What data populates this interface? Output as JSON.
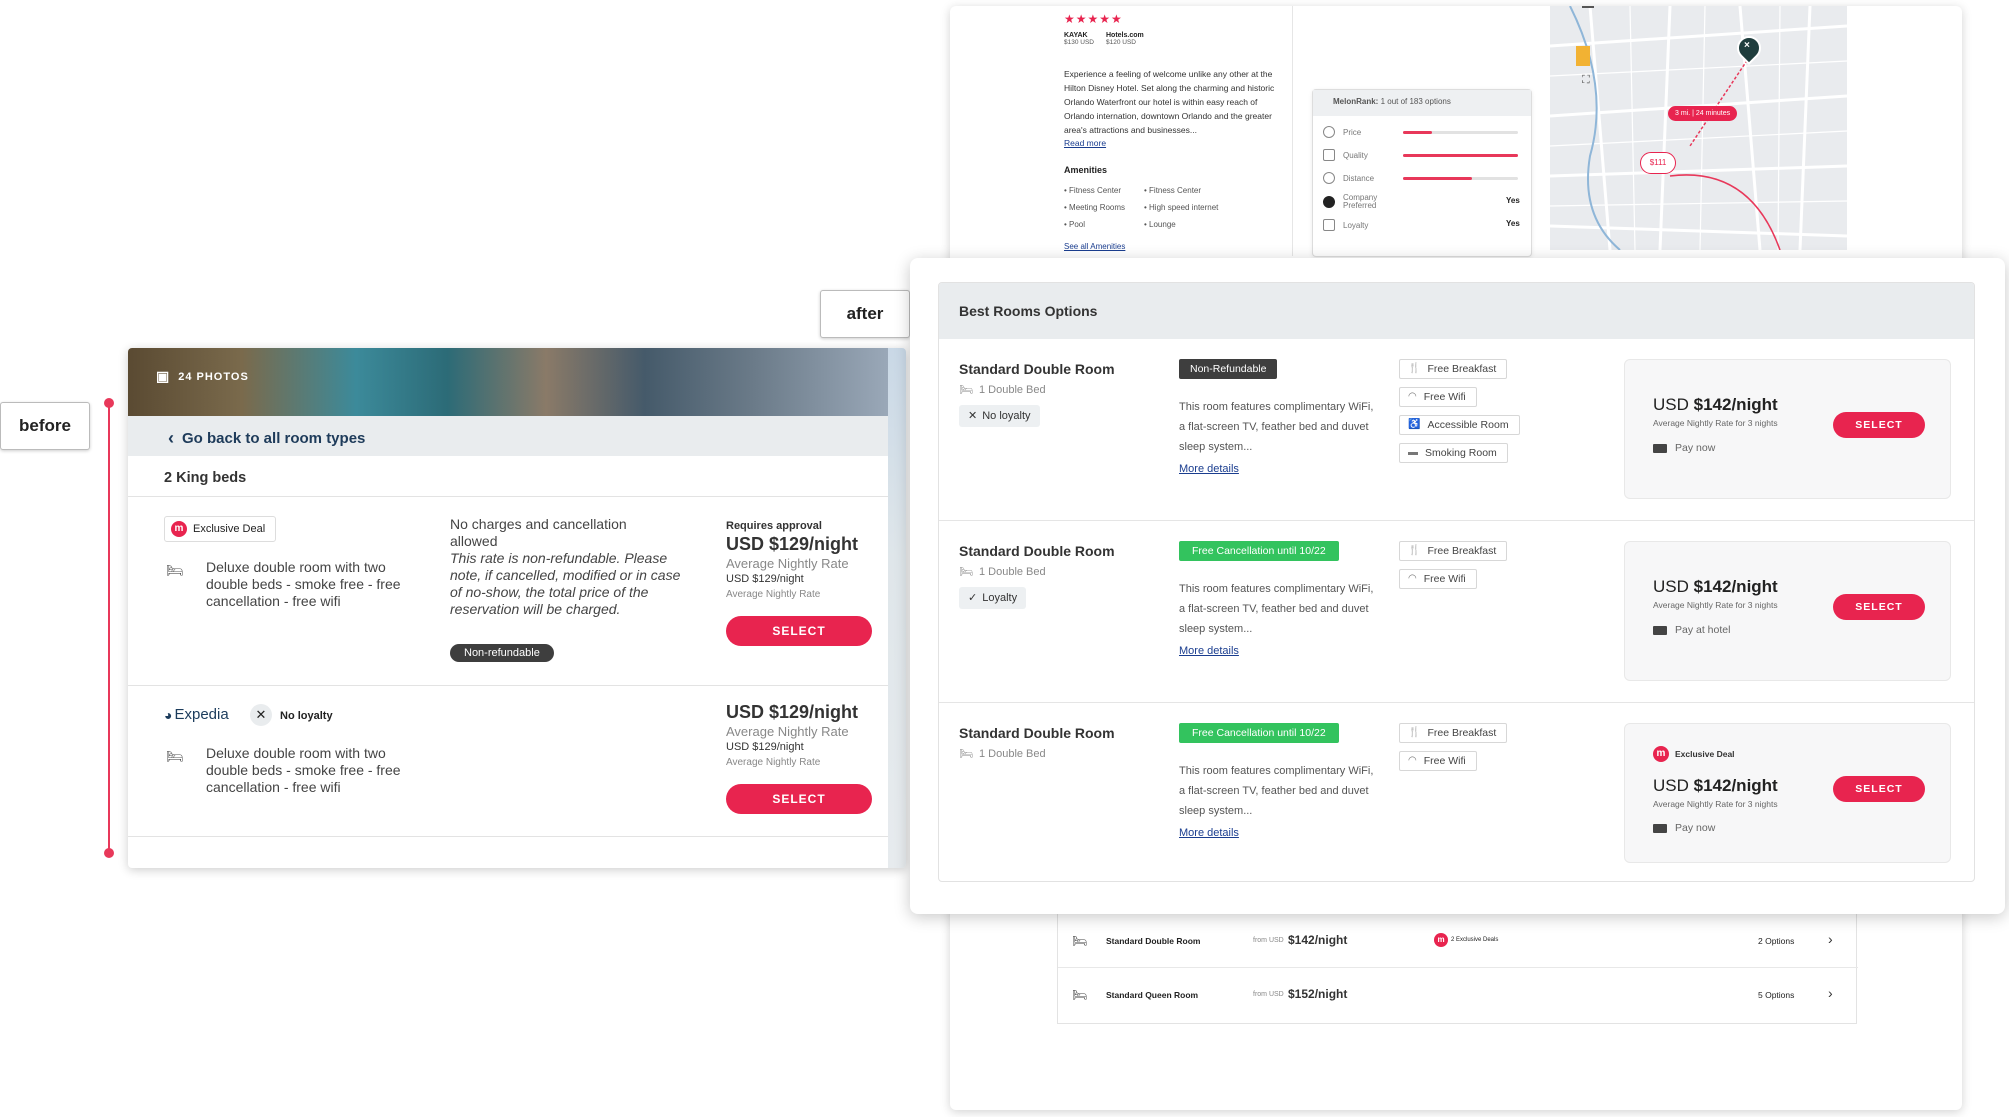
{
  "labels": {
    "before": "before",
    "after": "after"
  },
  "top_card": {
    "stars": "★★★★★",
    "sources": [
      {
        "name": "KAYAK",
        "price": "$130 USD"
      },
      {
        "name": "Hotels.com",
        "price": "$120 USD"
      }
    ],
    "description": "Experience a feeling of welcome unlike any other at the Hilton Disney Hotel. Set along the charming and historic Orlando Waterfront our hotel is within easy reach of Orlando internation, downtown Orlando and the greater area's attractions and businesses...",
    "read_more": "Read more",
    "amenities_title": "Amenities",
    "amenities": [
      "• Fitness Center",
      "• Fitness Center",
      "• Meeting Rooms",
      "• High speed internet",
      "• Pool",
      "• Lounge"
    ],
    "see_all": "See all Amenities",
    "melonrank": {
      "header_bold": "MelonRank:",
      "header_rest": " 1 out of 183 options",
      "rows": [
        {
          "label": "Price",
          "fill": 0.25
        },
        {
          "label": "Quality",
          "fill": 1.0
        },
        {
          "label": "Distance",
          "fill": 0.6
        },
        {
          "label": "Company Preferred",
          "value": "Yes"
        },
        {
          "label": "Loyalty",
          "value": "Yes"
        }
      ]
    },
    "map": {
      "route_label": "3 mi. | 24 minutes",
      "price_pin": "$111"
    },
    "room_list": [
      {
        "name": "Standard Double Room",
        "from": "from USD",
        "price": "$142/night",
        "deals": "2 Exclusive Deals",
        "options": "2 Options"
      },
      {
        "name": "Standard Queen Room",
        "from": "from USD",
        "price": "$152/night",
        "deals": "",
        "options": "5 Options"
      }
    ]
  },
  "before_card": {
    "photos": "24 PHOTOS",
    "back": "Go back to all room types",
    "section": "2 King beds",
    "offers": [
      {
        "badge": "Exclusive Deal",
        "room_desc": "Deluxe double room with two double beds - smoke free - free cancellation - free wifi",
        "policy_title": "No charges and cancellation allowed",
        "policy_note": "This rate is non-refundable. Please note, if cancelled, modified or in case of no-show, the total price of the reservation will be charged.",
        "policy_tag": "Non-refundable",
        "approval": "Requires approval",
        "price": "USD $129/night",
        "rate_label": "Average Nightly Rate",
        "price2": "USD $129/night",
        "rate_label2": "Average Nightly Rate",
        "select": "SELECT"
      },
      {
        "provider": "Expedia",
        "loyalty": "No loyalty",
        "room_desc": "Deluxe double room with two double beds - smoke free - free cancellation - free wifi",
        "price": "USD $129/night",
        "rate_label": "Average Nightly Rate",
        "price2": "USD $129/night",
        "rate_label2": "Average Nightly Rate",
        "select": "SELECT"
      }
    ]
  },
  "after_card": {
    "title": "Best Rooms Options",
    "rooms": [
      {
        "name": "Standard Double Room",
        "bed": "1 Double Bed",
        "loyalty": "No loyalty",
        "loyalty_icon": "✕",
        "policy": "Non-Refundable",
        "desc": "This room features complimentary WiFi, a flat-screen TV, feather bed and duvet sleep system...",
        "more": "More details",
        "amenities": [
          "Free Breakfast",
          "Free Wifi",
          "Accessible Room",
          "Smoking Room"
        ],
        "currency": "USD",
        "price": "$142/night",
        "rate": "Average Nightly Rate for 3 nights",
        "pay": "Pay now",
        "select": "SELECT"
      },
      {
        "name": "Standard Double Room",
        "bed": "1 Double Bed",
        "loyalty": "Loyalty",
        "loyalty_icon": "✓",
        "policy": "Free Cancellation until 10/22",
        "desc": "This room features complimentary WiFi, a flat-screen TV, feather bed and duvet sleep system...",
        "more": "More details",
        "amenities": [
          "Free Breakfast",
          "Free Wifi"
        ],
        "currency": "USD",
        "price": "$142/night",
        "rate": "Average Nightly Rate for 3 nights",
        "pay": "Pay at hotel",
        "select": "SELECT"
      },
      {
        "name": "Standard Double Room",
        "bed": "1 Double Bed",
        "policy": "Free Cancellation until 10/22",
        "desc": "This room features complimentary WiFi, a flat-screen TV, feather bed and duvet sleep system...",
        "more": "More details",
        "amenities": [
          "Free Breakfast",
          "Free Wifi"
        ],
        "deal": "Exclusive Deal",
        "currency": "USD",
        "price": "$142/night",
        "rate": "Average Nightly Rate for 3 nights",
        "pay": "Pay now",
        "select": "SELECT"
      }
    ]
  },
  "colors": {
    "accent": "#e8244f",
    "green": "#33c35e",
    "dark_tag": "#3e3e3e",
    "timeline": "#e8385a"
  }
}
